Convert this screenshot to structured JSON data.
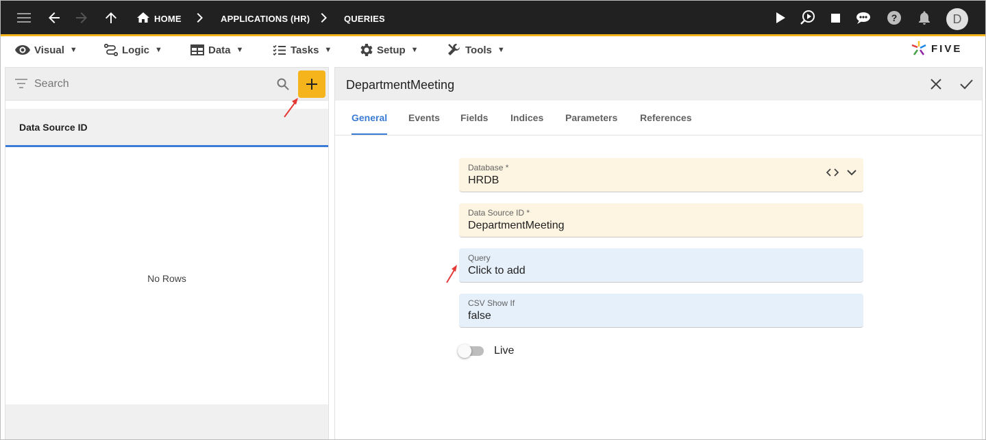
{
  "appbar": {
    "breadcrumbs": [
      {
        "label": "HOME",
        "icon": "home-icon"
      },
      {
        "label": "APPLICATIONS (HR)"
      },
      {
        "label": "QUERIES"
      }
    ],
    "user_initial": "D"
  },
  "menu": {
    "items": [
      {
        "label": "Visual",
        "icon": "eye-icon"
      },
      {
        "label": "Logic",
        "icon": "logic-icon"
      },
      {
        "label": "Data",
        "icon": "table-icon"
      },
      {
        "label": "Tasks",
        "icon": "tasks-icon"
      },
      {
        "label": "Setup",
        "icon": "gear-icon"
      },
      {
        "label": "Tools",
        "icon": "tools-icon"
      }
    ],
    "dropdown_glyph": "▼",
    "logo_text": "FIVE"
  },
  "list_panel": {
    "search_placeholder": "Search",
    "column_header": "Data Source ID",
    "empty_text": "No Rows"
  },
  "form": {
    "title": "DepartmentMeeting",
    "tabs": [
      "General",
      "Events",
      "Fields",
      "Indices",
      "Parameters",
      "References"
    ],
    "active_tab": "General",
    "fields": {
      "database": {
        "label": "Database *",
        "value": "HRDB"
      },
      "data_source_id": {
        "label": "Data Source ID *",
        "value": "DepartmentMeeting"
      },
      "query": {
        "label": "Query",
        "value": "Click to add"
      },
      "csv_show_if": {
        "label": "CSV Show If",
        "value": "false"
      }
    },
    "live_toggle": {
      "label": "Live",
      "on": false
    }
  },
  "colors": {
    "appbar_bg": "#212121",
    "accent": "#f5b41b",
    "tab_active": "#3a7bd5",
    "required_field_bg": "#fdf5e1",
    "optional_field_bg": "#e6f0fb"
  }
}
